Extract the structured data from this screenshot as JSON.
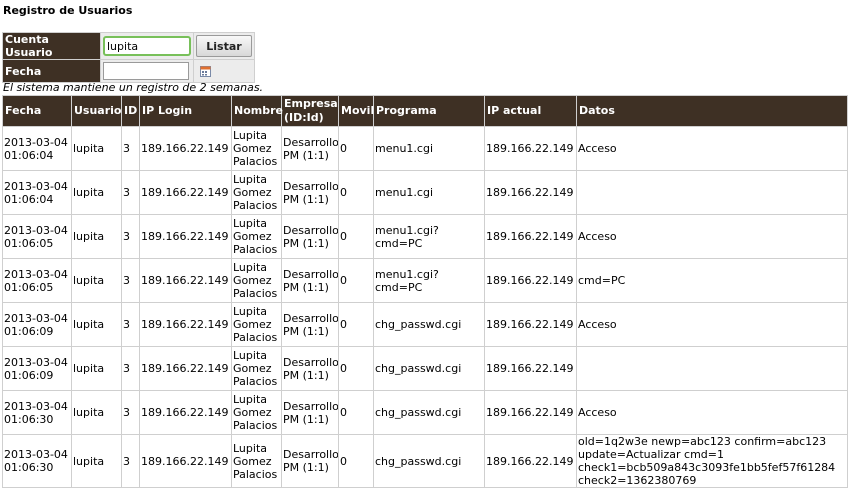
{
  "page_title": "Registro de Usuarios",
  "filter": {
    "user_label": "Cuenta Usuario",
    "user_value": "lupita",
    "list_button": "Listar",
    "date_label": "Fecha",
    "date_value": ""
  },
  "note": "El sistema mantiene un registro de 2 semanas.",
  "table": {
    "headers": [
      "Fecha",
      "Usuario",
      "ID",
      "IP Login",
      "Nombre",
      "Empresa\n(ID:Id)",
      "Movil",
      "Programa",
      "IP actual",
      "Datos"
    ],
    "rows": [
      [
        "2013-03-04\n01:06:04",
        "lupita",
        "3",
        "189.166.22.149",
        "Lupita\nGomez\nPalacios",
        "Desarrollo\nPM (1:1)",
        "0",
        "menu1.cgi",
        "189.166.22.149",
        "Acceso"
      ],
      [
        "2013-03-04\n01:06:04",
        "lupita",
        "3",
        "189.166.22.149",
        "Lupita\nGomez\nPalacios",
        "Desarrollo\nPM (1:1)",
        "0",
        "menu1.cgi",
        "189.166.22.149",
        ""
      ],
      [
        "2013-03-04\n01:06:05",
        "lupita",
        "3",
        "189.166.22.149",
        "Lupita\nGomez\nPalacios",
        "Desarrollo\nPM (1:1)",
        "0",
        "menu1.cgi?cmd=PC",
        "189.166.22.149",
        "Acceso"
      ],
      [
        "2013-03-04\n01:06:05",
        "lupita",
        "3",
        "189.166.22.149",
        "Lupita\nGomez\nPalacios",
        "Desarrollo\nPM (1:1)",
        "0",
        "menu1.cgi?cmd=PC",
        "189.166.22.149",
        "cmd=PC"
      ],
      [
        "2013-03-04\n01:06:09",
        "lupita",
        "3",
        "189.166.22.149",
        "Lupita\nGomez\nPalacios",
        "Desarrollo\nPM (1:1)",
        "0",
        "chg_passwd.cgi",
        "189.166.22.149",
        "Acceso"
      ],
      [
        "2013-03-04\n01:06:09",
        "lupita",
        "3",
        "189.166.22.149",
        "Lupita\nGomez\nPalacios",
        "Desarrollo\nPM (1:1)",
        "0",
        "chg_passwd.cgi",
        "189.166.22.149",
        ""
      ],
      [
        "2013-03-04\n01:06:30",
        "lupita",
        "3",
        "189.166.22.149",
        "Lupita\nGomez\nPalacios",
        "Desarrollo\nPM (1:1)",
        "0",
        "chg_passwd.cgi",
        "189.166.22.149",
        "Acceso"
      ],
      [
        "2013-03-04\n01:06:30",
        "lupita",
        "3",
        "189.166.22.149",
        "Lupita\nGomez\nPalacios",
        "Desarrollo\nPM (1:1)",
        "0",
        "chg_passwd.cgi",
        "189.166.22.149",
        "old=1q2w3e newp=abc123 confirm=abc123\nupdate=Actualizar cmd=1\ncheck1=bcb509a843c3093fe1bb5fef57f61284\ncheck2=1362380769"
      ]
    ]
  }
}
